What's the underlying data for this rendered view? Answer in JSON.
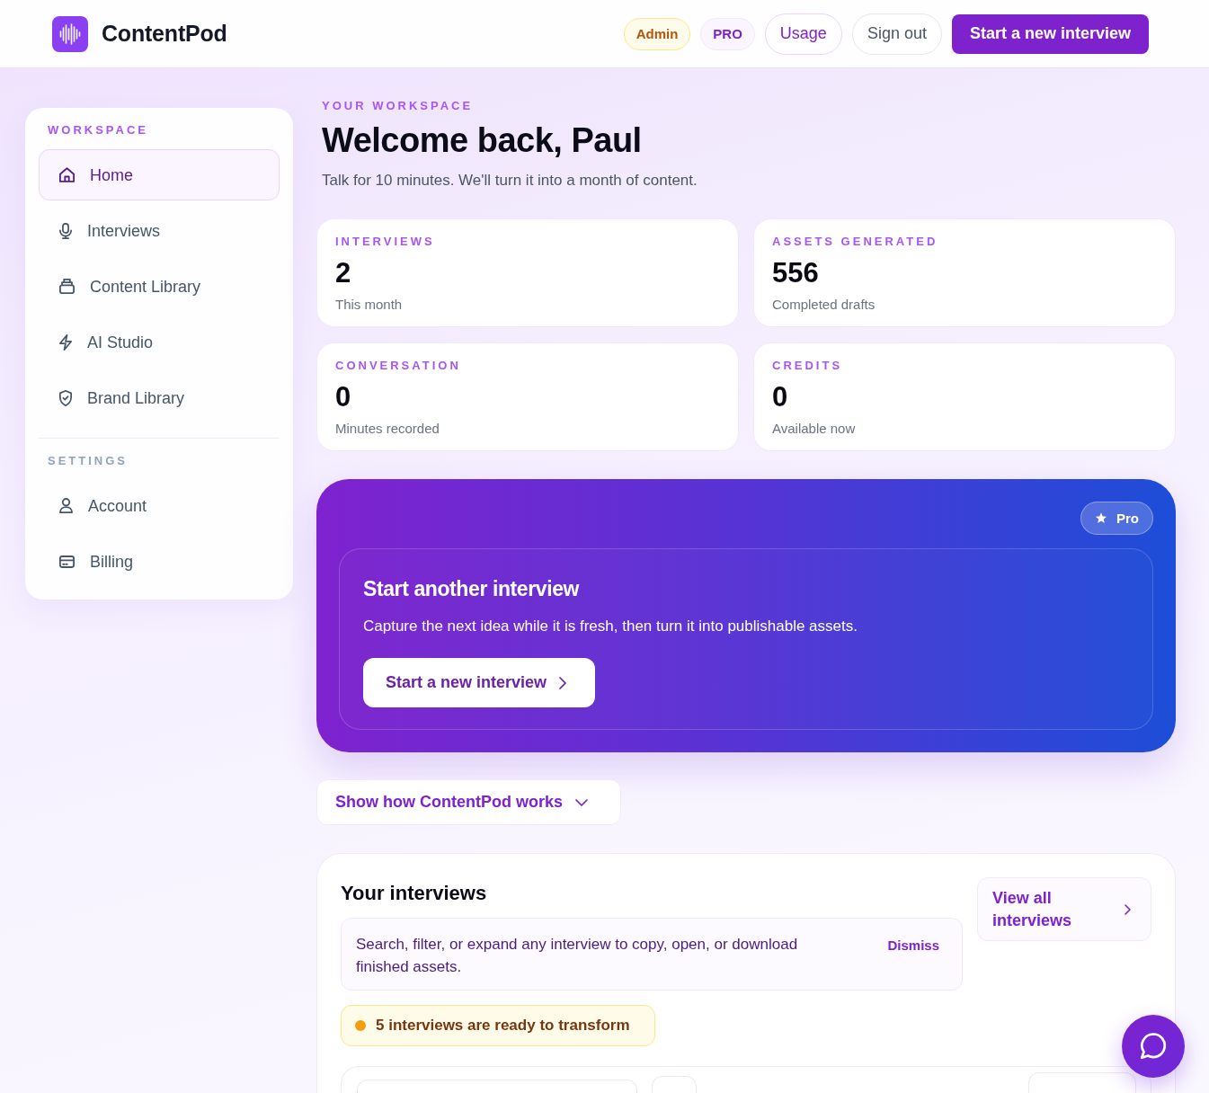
{
  "header": {
    "brand": "ContentPod",
    "badges": [
      {
        "label": "Admin",
        "kind": "role"
      },
      {
        "label": "PRO",
        "kind": "plan"
      }
    ],
    "buttons": [
      {
        "label": "Usage",
        "kind": "outline"
      },
      {
        "label": "Sign out",
        "kind": "plain"
      },
      {
        "label": "Start a new interview",
        "kind": "primary"
      }
    ]
  },
  "sidebar": {
    "sections": [
      {
        "title": "WORKSPACE",
        "items": [
          {
            "label": "Home",
            "selected": true
          },
          {
            "label": "Interviews",
            "selected": false
          },
          {
            "label": "Content Library",
            "selected": false
          },
          {
            "label": "AI Studio",
            "selected": false
          },
          {
            "label": "Brand Library",
            "selected": false
          }
        ]
      },
      {
        "title": "SETTINGS",
        "items": [
          {
            "label": "Account",
            "selected": false
          },
          {
            "label": "Billing",
            "selected": false
          }
        ]
      }
    ]
  },
  "hero": {
    "eyebrow": "YOUR WORKSPACE",
    "title": "Welcome back, Paul",
    "subtitle": "Talk for 10 minutes. We'll turn it into a month of content."
  },
  "stats": [
    {
      "label": "INTERVIEWS",
      "value": "2",
      "caption": "This month"
    },
    {
      "label": "ASSETS GENERATED",
      "value": "556",
      "caption": "Completed drafts"
    },
    {
      "label": "CONVERSATION",
      "value": "0",
      "caption": "Minutes recorded"
    },
    {
      "label": "CREDITS",
      "value": "0",
      "caption": "Available now"
    }
  ],
  "promo": {
    "badge": "Pro",
    "title": "Start another interview",
    "text": "Capture the next idea while it is fresh, then turn it into publishable assets.",
    "button": "Start a new interview"
  },
  "how_it_works": {
    "label": "Show how ContentPod works",
    "expanded": false
  },
  "interviews": {
    "title": "Your interviews",
    "view_all": "View all interviews",
    "tip": {
      "text": "Search, filter, or expand any interview to copy, open, or download finished assets.",
      "dismiss": "Dismiss"
    },
    "ready_notice": "5 interviews are ready to transform"
  }
}
